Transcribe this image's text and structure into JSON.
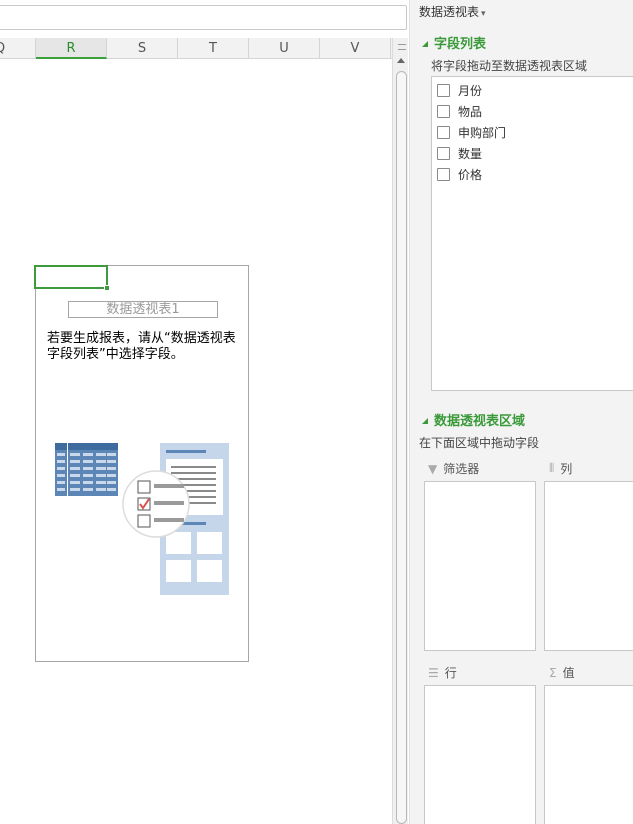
{
  "sheet": {
    "columns": [
      {
        "label": "Q",
        "active": false
      },
      {
        "label": "R",
        "active": true
      },
      {
        "label": "S",
        "active": false
      },
      {
        "label": "T",
        "active": false
      },
      {
        "label": "U",
        "active": false
      },
      {
        "label": "V",
        "active": false
      }
    ],
    "pivot_placeholder": {
      "name": "数据透视表1",
      "hint": "若要生成报表，请从“数据透视表字段列表”中选择字段。"
    }
  },
  "panel": {
    "title": "数据透视表",
    "title_dropdown": "▾",
    "field_section": {
      "heading": "字段列表",
      "subtitle": "将字段拖动至数据透视表区域",
      "fields": [
        {
          "label": "月份",
          "checked": false
        },
        {
          "label": "物品",
          "checked": false
        },
        {
          "label": "申购部门",
          "checked": false
        },
        {
          "label": "数量",
          "checked": false
        },
        {
          "label": "价格",
          "checked": false
        }
      ]
    },
    "area_section": {
      "heading": "数据透视表区域",
      "subtitle": "在下面区域中拖动字段",
      "areas": {
        "filter": {
          "label": "筛选器",
          "icon": "filter-icon"
        },
        "columns": {
          "label": "列",
          "icon": "columns-icon"
        },
        "rows": {
          "label": "行",
          "icon": "rows-icon"
        },
        "values": {
          "label": "值",
          "icon": "sigma-icon"
        }
      }
    }
  },
  "colors": {
    "accent_green": "#3a9a3a",
    "active_column": "#2e8b2e",
    "illustration_blue": "#5b86b5",
    "illustration_light": "#c5d6ea",
    "check_red": "#d9534f"
  }
}
